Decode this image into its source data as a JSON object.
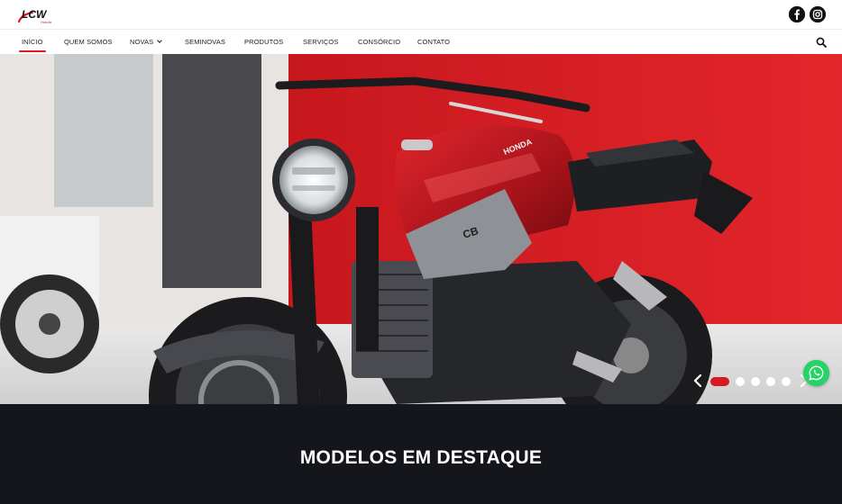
{
  "brand": {
    "logo_text": "LCW",
    "logo_subtext": "Honda"
  },
  "social": {
    "facebook": "facebook-icon",
    "instagram": "instagram-icon"
  },
  "nav": {
    "items": [
      {
        "label": "INÍCIO",
        "active": true
      },
      {
        "label": "QUEM SOMOS",
        "active": false
      },
      {
        "label": "NOVAS",
        "active": false,
        "dropdown": true
      },
      {
        "label": "SEMINOVAS",
        "active": false
      },
      {
        "label": "PRODUTOS",
        "active": false
      },
      {
        "label": "SERVIÇOS",
        "active": false
      },
      {
        "label": "CONSÓRCIO",
        "active": false
      },
      {
        "label": "CONTATO",
        "active": false
      }
    ],
    "search_icon": "search-icon"
  },
  "hero": {
    "bike_badge": "CB",
    "tank_brand": "HONDA",
    "carousel": {
      "slide_count": 5,
      "active_index": 0
    }
  },
  "featured": {
    "heading": "MODELOS EM DESTAQUE"
  },
  "colors": {
    "accent": "#d71920",
    "dark_section": "#15161b",
    "whatsapp": "#25d366"
  }
}
